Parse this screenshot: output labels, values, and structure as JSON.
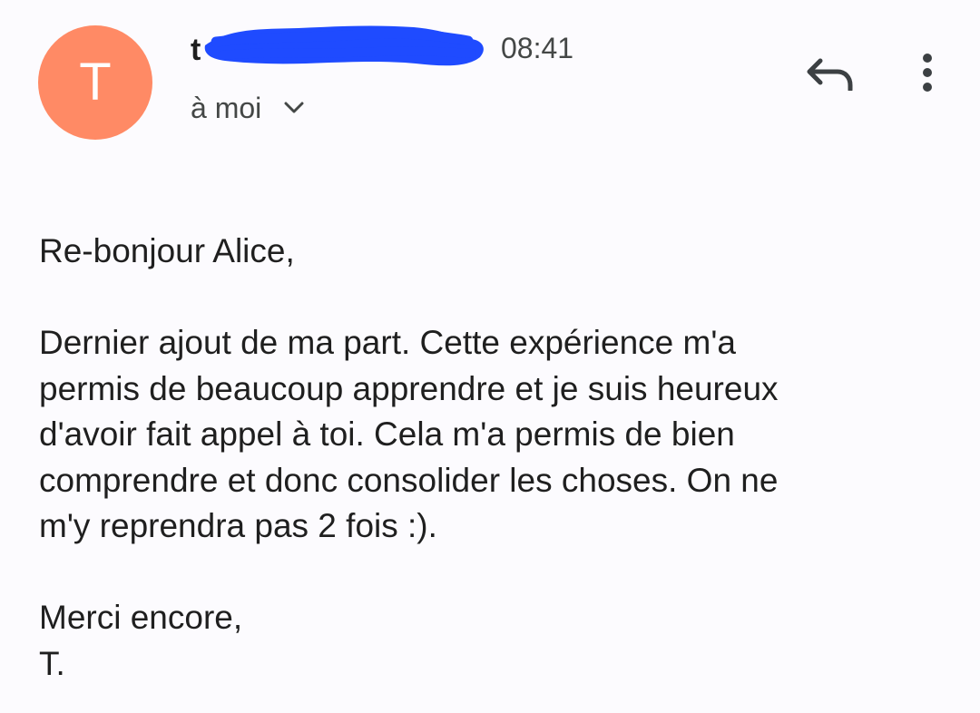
{
  "header": {
    "avatar_letter": "T",
    "avatar_color": "#ff8a65",
    "sender_visible": "t",
    "redaction_color": "#1f4bff",
    "time": "08:41",
    "recipient": "à moi",
    "icons": {
      "chevron": "chevron-down-icon",
      "reply": "reply-icon",
      "more": "more-vert-icon"
    }
  },
  "message": {
    "greeting": "Re-bonjour Alice,",
    "body_lines": [
      "Dernier ajout de ma part. Cette expérience m'a",
      "permis de beaucoup apprendre et je suis heureux",
      "d'avoir fait appel à toi. Cela m'a permis de bien",
      "comprendre et donc consolider les choses. On ne",
      "m'y reprendra pas 2 fois :)."
    ],
    "closing": "Merci encore,",
    "signature": "T."
  }
}
